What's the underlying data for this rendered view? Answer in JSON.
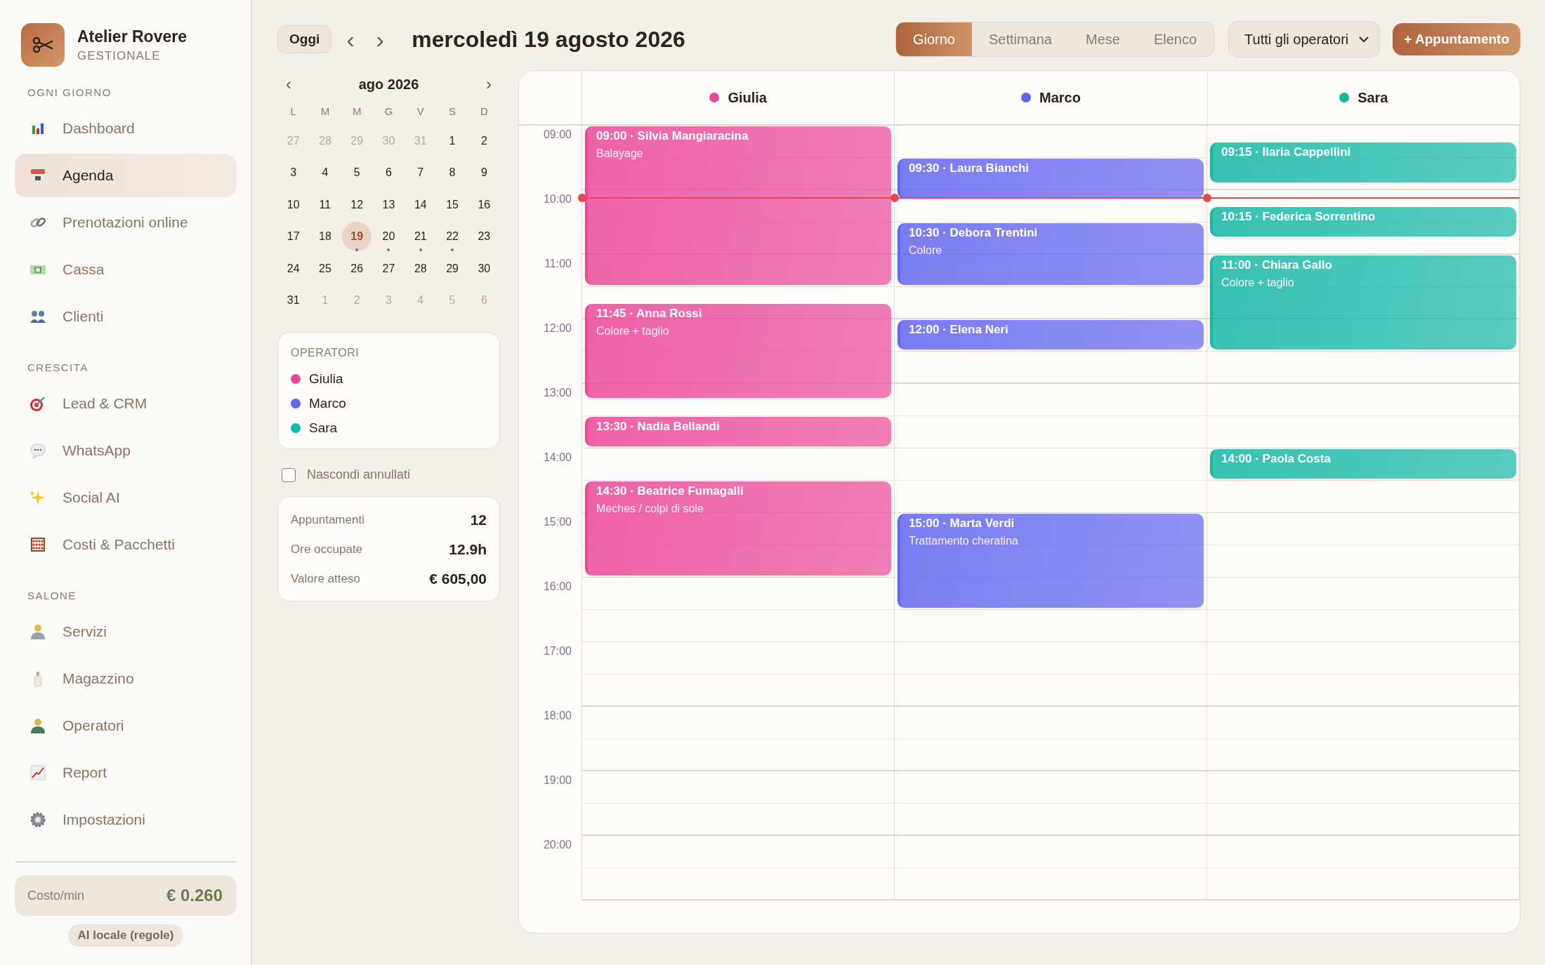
{
  "brand": {
    "name": "Atelier Rovere",
    "subtitle": "GESTIONALE"
  },
  "sidebar": {
    "sections": [
      {
        "title": "OGNI GIORNO",
        "items": [
          {
            "label": "Dashboard",
            "selected": false
          },
          {
            "label": "Agenda",
            "selected": true
          },
          {
            "label": "Prenotazioni online",
            "selected": false
          },
          {
            "label": "Cassa",
            "selected": false
          },
          {
            "label": "Clienti",
            "selected": false
          }
        ]
      },
      {
        "title": "CRESCITA",
        "items": [
          {
            "label": "Lead & CRM",
            "selected": false
          },
          {
            "label": "WhatsApp",
            "selected": false
          },
          {
            "label": "Social AI",
            "selected": false
          },
          {
            "label": "Costi & Pacchetti",
            "selected": false
          }
        ]
      },
      {
        "title": "SALONE",
        "items": [
          {
            "label": "Servizi",
            "selected": false
          },
          {
            "label": "Magazzino",
            "selected": false
          },
          {
            "label": "Operatori",
            "selected": false
          },
          {
            "label": "Report",
            "selected": false
          },
          {
            "label": "Impostazioni",
            "selected": false
          }
        ]
      }
    ],
    "cost": {
      "label": "Costo/min",
      "value": "€ 0.260"
    },
    "badge": "AI locale (regole)"
  },
  "toolbar": {
    "today": "Oggi",
    "prev": "‹",
    "next": "›",
    "title": "mercoledì 19 agosto 2026",
    "views": [
      {
        "label": "Giorno",
        "selected": true
      },
      {
        "label": "Settimana",
        "selected": false
      },
      {
        "label": "Mese",
        "selected": false
      },
      {
        "label": "Elenco",
        "selected": false
      }
    ],
    "operator_select": "Tutti gli operatori",
    "add_button": "+ Appuntamento"
  },
  "mini_calendar": {
    "title": "ago 2026",
    "prev": "‹",
    "next": "›",
    "weekdays": [
      "L",
      "M",
      "M",
      "G",
      "V",
      "S",
      "D"
    ],
    "days": [
      {
        "day": "27",
        "muted": true,
        "selected": false,
        "has_events": false
      },
      {
        "day": "28",
        "muted": true,
        "selected": false,
        "has_events": false
      },
      {
        "day": "29",
        "muted": true,
        "selected": false,
        "has_events": false
      },
      {
        "day": "30",
        "muted": true,
        "selected": false,
        "has_events": false
      },
      {
        "day": "31",
        "muted": true,
        "selected": false,
        "has_events": false
      },
      {
        "day": "1",
        "muted": false,
        "selected": false,
        "has_events": false
      },
      {
        "day": "2",
        "muted": false,
        "selected": false,
        "has_events": false
      },
      {
        "day": "3",
        "muted": false,
        "selected": false,
        "has_events": false
      },
      {
        "day": "4",
        "muted": false,
        "selected": false,
        "has_events": false
      },
      {
        "day": "5",
        "muted": false,
        "selected": false,
        "has_events": false
      },
      {
        "day": "6",
        "muted": false,
        "selected": false,
        "has_events": false
      },
      {
        "day": "7",
        "muted": false,
        "selected": false,
        "has_events": false
      },
      {
        "day": "8",
        "muted": false,
        "selected": false,
        "has_events": false
      },
      {
        "day": "9",
        "muted": false,
        "selected": false,
        "has_events": false
      },
      {
        "day": "10",
        "muted": false,
        "selected": false,
        "has_events": false
      },
      {
        "day": "11",
        "muted": false,
        "selected": false,
        "has_events": false
      },
      {
        "day": "12",
        "muted": false,
        "selected": false,
        "has_events": false
      },
      {
        "day": "13",
        "muted": false,
        "selected": false,
        "has_events": false
      },
      {
        "day": "14",
        "muted": false,
        "selected": false,
        "has_events": false
      },
      {
        "day": "15",
        "muted": false,
        "selected": false,
        "has_events": false
      },
      {
        "day": "16",
        "muted": false,
        "selected": false,
        "has_events": false
      },
      {
        "day": "17",
        "muted": false,
        "selected": false,
        "has_events": false
      },
      {
        "day": "18",
        "muted": false,
        "selected": false,
        "has_events": false
      },
      {
        "day": "19",
        "muted": false,
        "selected": true,
        "has_events": true
      },
      {
        "day": "20",
        "muted": false,
        "selected": false,
        "has_events": true
      },
      {
        "day": "21",
        "muted": false,
        "selected": false,
        "has_events": true
      },
      {
        "day": "22",
        "muted": false,
        "selected": false,
        "has_events": true
      },
      {
        "day": "23",
        "muted": false,
        "selected": false,
        "has_events": false
      },
      {
        "day": "24",
        "muted": false,
        "selected": false,
        "has_events": false
      },
      {
        "day": "25",
        "muted": false,
        "selected": false,
        "has_events": false
      },
      {
        "day": "26",
        "muted": false,
        "selected": false,
        "has_events": false
      },
      {
        "day": "27",
        "muted": false,
        "selected": false,
        "has_events": false
      },
      {
        "day": "28",
        "muted": false,
        "selected": false,
        "has_events": false
      },
      {
        "day": "29",
        "muted": false,
        "selected": false,
        "has_events": false
      },
      {
        "day": "30",
        "muted": false,
        "selected": false,
        "has_events": false
      },
      {
        "day": "31",
        "muted": false,
        "selected": false,
        "has_events": false
      },
      {
        "day": "1",
        "muted": true,
        "selected": false,
        "has_events": false
      },
      {
        "day": "2",
        "muted": true,
        "selected": false,
        "has_events": false
      },
      {
        "day": "3",
        "muted": true,
        "selected": false,
        "has_events": false
      },
      {
        "day": "4",
        "muted": true,
        "selected": false,
        "has_events": false
      },
      {
        "day": "5",
        "muted": true,
        "selected": false,
        "has_events": false
      },
      {
        "day": "6",
        "muted": true,
        "selected": false,
        "has_events": false
      }
    ]
  },
  "operators_card": {
    "title": "OPERATORI",
    "operators": [
      {
        "name": "Giulia",
        "color": "#ec4899"
      },
      {
        "name": "Marco",
        "color": "#6366f1"
      },
      {
        "name": "Sara",
        "color": "#14b8a6"
      }
    ]
  },
  "hide_cancelled": {
    "label": "Nascondi annullati",
    "checked": false
  },
  "stats": [
    {
      "label": "Appuntamenti",
      "value": "12"
    },
    {
      "label": "Ore occupate",
      "value": "12.9h"
    },
    {
      "label": "Valore atteso",
      "value": "€ 605,00"
    }
  ],
  "agenda": {
    "time_labels": [
      {
        "label": "09:00",
        "now": false
      },
      {
        "label": "10:00",
        "now": true
      },
      {
        "label": "11:00",
        "now": false
      },
      {
        "label": "12:00",
        "now": false
      },
      {
        "label": "13:00",
        "now": false
      },
      {
        "label": "14:00",
        "now": false
      },
      {
        "label": "15:00",
        "now": false
      },
      {
        "label": "16:00",
        "now": false
      },
      {
        "label": "17:00",
        "now": false
      },
      {
        "label": "18:00",
        "now": false
      },
      {
        "label": "19:00",
        "now": false
      },
      {
        "label": "20:00",
        "now": false
      }
    ],
    "columns": [
      {
        "name": "Giulia",
        "color": "#ec4899",
        "events": [
          {
            "title": "09:00 · Silvia Mangiaracina",
            "service": "Balayage",
            "kind": "huge"
          },
          {
            "title": "11:45 · Anna Rossi",
            "service": "Colore + taglio",
            "kind": "large"
          },
          {
            "title": "13:30 · Nadia Bellandi",
            "kind": "tiny"
          },
          {
            "title": "14:30 · Beatrice Fumagalli",
            "service": "Meches / colpi di sole",
            "kind": "large"
          }
        ]
      },
      {
        "name": "Marco",
        "color": "#6366f1",
        "events": [
          {
            "title": "09:30 · Laura Bianchi",
            "kind": "small"
          },
          {
            "title": "10:30 · Debora Trentini",
            "service": "Colore",
            "kind": "medium"
          },
          {
            "title": "12:00 · Elena Neri",
            "kind": "tiny"
          },
          {
            "title": "15:00 · Marta Verdi",
            "service": "Trattamento cheratina",
            "kind": "large"
          }
        ]
      },
      {
        "name": "Sara",
        "color": "#14b8a6",
        "events": [
          {
            "title": "09:15 · Ilaria Cappellini",
            "kind": "small"
          },
          {
            "title": "10:15 · Federica Sorrentino",
            "kind": "tiny"
          },
          {
            "title": "11:00 · Chiara Gallo",
            "service": "Colore + taglio",
            "kind": "large"
          },
          {
            "title": "14:00 · Paola Costa",
            "kind": "tiny"
          }
        ]
      }
    ]
  }
}
